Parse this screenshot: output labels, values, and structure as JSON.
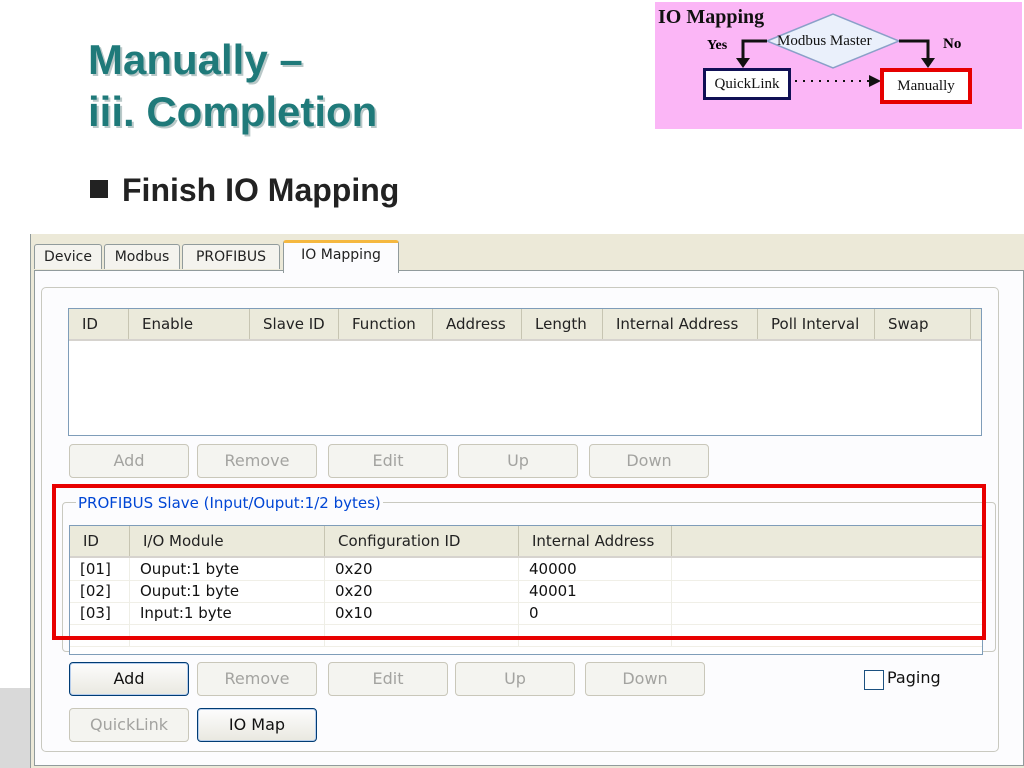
{
  "slide": {
    "title_line1": "Manually –",
    "title_line2": "iii. Completion",
    "bullet": "Finish IO Mapping"
  },
  "flow": {
    "title": "IO Mapping",
    "decision": "Modbus Master",
    "yes": "Yes",
    "no": "No",
    "quicklink": "QuickLink",
    "manually": "Manually"
  },
  "tabs": [
    "Device",
    "Modbus",
    "PROFIBUS",
    "IO Mapping"
  ],
  "modbus_table": {
    "columns": [
      "ID",
      "Enable",
      "Slave ID",
      "Function",
      "Address",
      "Length",
      "Internal Address",
      "Poll Interval",
      "Swap"
    ]
  },
  "buttons_top": {
    "add": "Add",
    "remove": "Remove",
    "edit": "Edit",
    "up": "Up",
    "down": "Down"
  },
  "group": {
    "label": "PROFIBUS Slave (Input/Ouput:1/2 bytes)"
  },
  "profibus_table": {
    "columns": [
      "ID",
      "I/O Module",
      "Configuration ID",
      "Internal Address"
    ],
    "rows": [
      [
        "[01]",
        "Ouput:1 byte",
        "0x20",
        "40000"
      ],
      [
        "[02]",
        "Ouput:1 byte",
        "0x20",
        "40001"
      ],
      [
        "[03]",
        "Input:1 byte",
        "0x10",
        "0"
      ]
    ]
  },
  "buttons_bottom": {
    "add": "Add",
    "remove": "Remove",
    "edit": "Edit",
    "up": "Up",
    "down": "Down"
  },
  "paging": {
    "label": "Paging",
    "checked": false
  },
  "footer_buttons": {
    "quicklink": "QuickLink",
    "iomap": "IO Map"
  },
  "colors": {
    "title": "#1f7a7a",
    "highlight": "#e80000",
    "diagram_bg": "#fbb6f6",
    "tab_accent": "#f5b840"
  }
}
